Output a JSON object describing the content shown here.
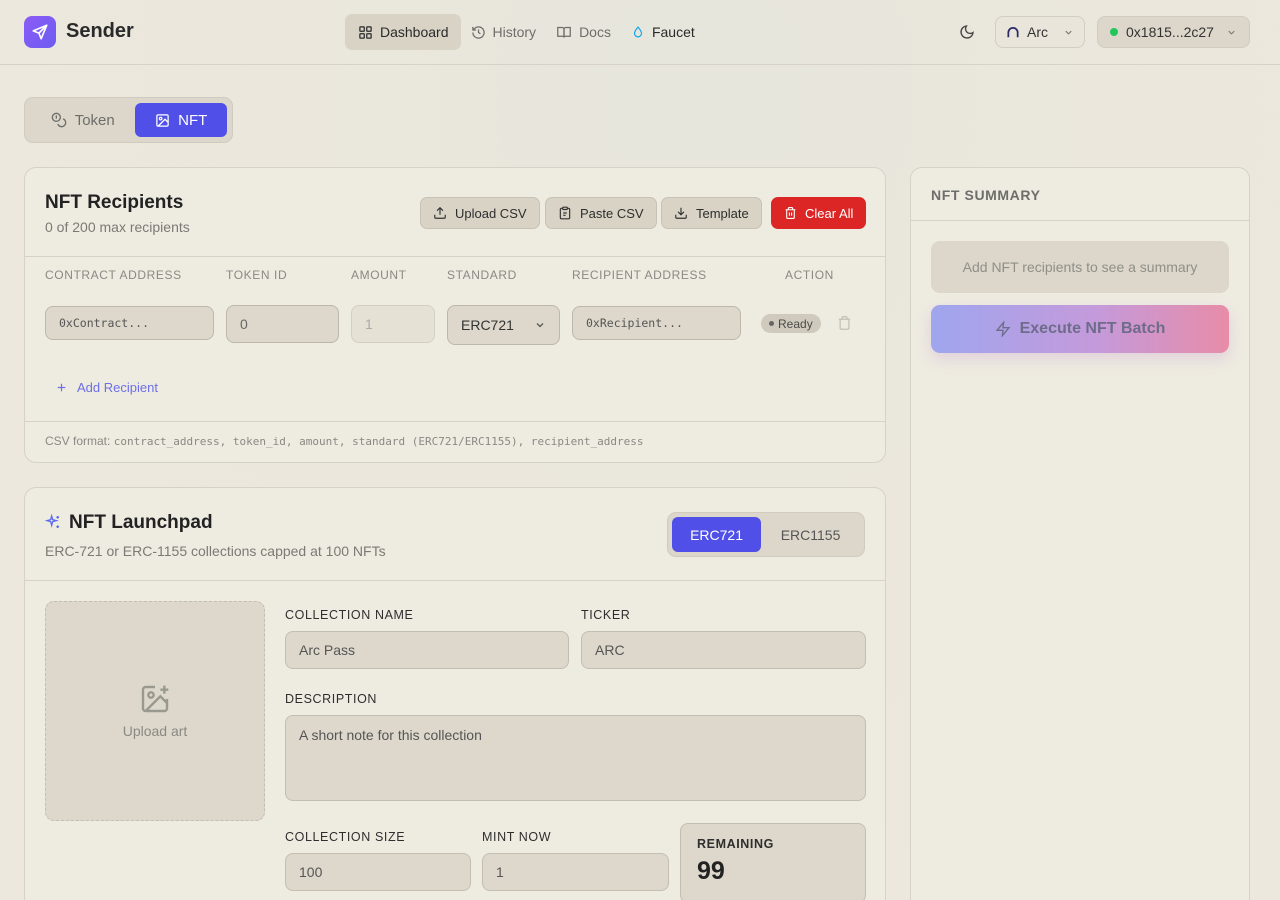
{
  "app": {
    "name": "Sender"
  },
  "nav": {
    "dashboard": "Dashboard",
    "history": "History",
    "docs": "Docs",
    "faucet": "Faucet"
  },
  "chain": {
    "label": "Arc"
  },
  "wallet": {
    "address": "0x1815...2c27"
  },
  "mode_toggle": {
    "token": "Token",
    "nft": "NFT",
    "selected": "NFT"
  },
  "recipients": {
    "title": "NFT Recipients",
    "subtitle": "0 of 200 max recipients",
    "toolbar": {
      "upload_csv": "Upload CSV",
      "paste_csv": "Paste CSV",
      "template": "Template",
      "clear_all": "Clear All"
    },
    "columns": [
      "CONTRACT ADDRESS",
      "TOKEN ID",
      "AMOUNT",
      "STANDARD",
      "RECIPIENT ADDRESS",
      "ACTION"
    ],
    "row": {
      "contract_placeholder": "0xContract...",
      "token_id": "0",
      "amount": "1",
      "standard": "ERC721",
      "recipient_placeholder": "0xRecipient...",
      "status": "Ready"
    },
    "add_label": "Add Recipient",
    "csv_format_label": "CSV format:",
    "csv_format_value": "contract_address, token_id, amount, standard (ERC721/ERC1155), recipient_address"
  },
  "launchpad": {
    "title": "NFT Launchpad",
    "subtitle": "ERC-721 or ERC-1155 collections capped at 100 NFTs",
    "standards": [
      "ERC721",
      "ERC1155"
    ],
    "selected_standard": "ERC721",
    "upload_art": "Upload art",
    "collection_name_label": "COLLECTION NAME",
    "collection_name_placeholder": "Arc Pass",
    "ticker_label": "TICKER",
    "ticker_placeholder": "ARC",
    "description_label": "DESCRIPTION",
    "description_placeholder": "A short note for this collection",
    "collection_size_label": "COLLECTION SIZE",
    "collection_size": "100",
    "mint_now_label": "MINT NOW",
    "mint_now": "1",
    "remaining_label": "REMAINING",
    "remaining_value": "99"
  },
  "summary": {
    "title": "NFT SUMMARY",
    "empty_text": "Add NFT recipients to see a summary",
    "execute_label": "Execute NFT Batch"
  },
  "colors": {
    "accent": "#5050e8",
    "danger": "#dc2626",
    "status_online": "#22c55e"
  }
}
